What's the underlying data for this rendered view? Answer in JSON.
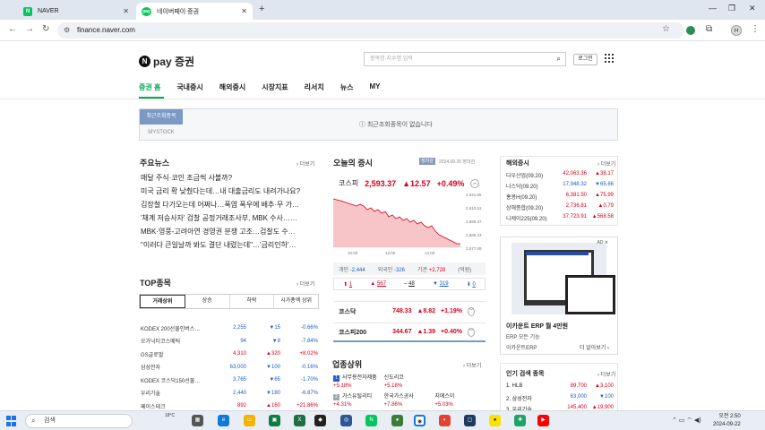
{
  "browser": {
    "tabs": [
      {
        "label": "NAVER",
        "favicon": "N"
      },
      {
        "label": "네이버페이 증권",
        "favicon": "pay"
      }
    ],
    "url": "finance.naver.com",
    "profile_initial": "H"
  },
  "header": {
    "logo_text": "pay 증권",
    "logo_mark": "N",
    "search_placeholder": "종목명·지수명 입력",
    "login_label": "로그인"
  },
  "gnb": [
    "증권 홈",
    "국내증시",
    "해외증시",
    "시장지표",
    "리서치",
    "뉴스",
    "MY"
  ],
  "recent": {
    "tab_recent": "최근조회종목",
    "tab_mystock": "MYSTOCK",
    "message": "최근조회종목이 없습니다"
  },
  "news": {
    "title": "주요뉴스",
    "more": "더보기",
    "items": [
      "매달 주식·코인 조금씩 사볼까?",
      "미국 금리 확 낮췄다는데…내 대출금리도 내려가나요?",
      "김장철 다가오는데 어쩌나…폭염 폭우에 배추·무 가…",
      "'채계 저승사자' 검찰 공정거래조사부, MBK 수사……",
      "MBK·영풍-고려아연 경영권 분쟁 고조…검찰도 수…",
      "\"이러다 큰일날까 봐도 결단 내렸는데\"…'금리인하'…"
    ]
  },
  "top": {
    "title": "TOP종목",
    "more": "더보기",
    "tabs": [
      "거래상위",
      "상승",
      "하락",
      "시가총액 상위"
    ],
    "rows": [
      {
        "name": "KODEX 200선물인버스…",
        "price": "2,255",
        "change": "▼15",
        "pct": "-0.66%",
        "dir": "dn"
      },
      {
        "name": "오가닉티코스메틱",
        "price": "94",
        "change": "▼8",
        "pct": "-7.84%",
        "dir": "dn"
      },
      {
        "name": "GS글로벌",
        "price": "4,310",
        "change": "▲320",
        "pct": "+8.02%",
        "dir": "up"
      },
      {
        "name": "삼성전자",
        "price": "63,000",
        "change": "▼100",
        "pct": "-0.16%",
        "dir": "dn"
      },
      {
        "name": "KODEX 코스닥150선물…",
        "price": "3,765",
        "change": "▼65",
        "pct": "-1.70%",
        "dir": "dn"
      },
      {
        "name": "우리기술",
        "price": "2,440",
        "change": "▼180",
        "pct": "-6.87%",
        "dir": "dn"
      },
      {
        "name": "페이스테크",
        "price": "892",
        "change": "▲160",
        "pct": "+21.86%",
        "dir": "up"
      }
    ]
  },
  "market": {
    "title": "오늘의 증시",
    "badge": "장마감",
    "date": "2024.09.20 장마감",
    "kospi": {
      "name": "코스피",
      "value": "2,593.37",
      "change": "▲12.57",
      "pct": "+0.49%"
    },
    "chart_yticks": [
      "2,621.65",
      "2,610.51",
      "2,599.37",
      "2,588.23",
      "2,577.09"
    ],
    "chart_xticks": [
      "10:00",
      "12:00",
      "14:00"
    ],
    "investors": [
      {
        "label": "개인",
        "value": "-2,444",
        "dir": "dn"
      },
      {
        "label": "외국인",
        "value": "-326",
        "dir": "dn"
      },
      {
        "label": "기관",
        "value": "+2,728",
        "dir": "up"
      },
      {
        "label": "(억원)",
        "value": "",
        "dir": ""
      }
    ],
    "arrows": [
      {
        "sym": "⬆",
        "val": "1",
        "dir": "up"
      },
      {
        "sym": "▲",
        "val": "567",
        "dir": "up"
      },
      {
        "sym": "–",
        "val": "48",
        "dir": ""
      },
      {
        "sym": "▼",
        "val": "319",
        "dir": "dn"
      },
      {
        "sym": "⬇",
        "val": "0",
        "dir": "dn"
      }
    ],
    "kosdaq": {
      "name": "코스닥",
      "value": "748.33",
      "change": "▲8.82",
      "pct": "+1.19%"
    },
    "kospi200": {
      "name": "코스피200",
      "value": "344.67",
      "change": "▲1.39",
      "pct": "+0.40%"
    }
  },
  "sectors": {
    "title": "업종상위",
    "more": "더보기",
    "rows": [
      [
        {
          "rank": "1",
          "name": "사무용전자제품",
          "pct": "+5.18%"
        },
        {
          "name": "신도리코",
          "pct": "+5.18%"
        },
        {
          "name": "",
          "pct": ""
        }
      ],
      [
        {
          "rank": "2",
          "name": "가스유틸리티",
          "pct": "+4.31%"
        },
        {
          "name": "한국가스공사",
          "pct": "+7.86%"
        },
        {
          "name": "지에스이",
          "pct": "+5.03%"
        }
      ]
    ]
  },
  "world": {
    "title": "해외증시",
    "more": "더보기",
    "rows": [
      {
        "name": "다우산업(09.20)",
        "price": "42,063.36",
        "change": "▲38.17",
        "dir": "up"
      },
      {
        "name": "나스닥(09.20)",
        "price": "17,948.32",
        "change": "▼65.66",
        "dir": "dn"
      },
      {
        "name": "홍콩H(09.20)",
        "price": "6,381.50",
        "change": "▲75.99",
        "dir": "up"
      },
      {
        "name": "상해종합(09.20)",
        "price": "2,736.81",
        "change": "▲0.79",
        "dir": "up"
      },
      {
        "name": "니케이225(09.20)",
        "price": "37,723.91",
        "change": "▲568.58",
        "dir": "up"
      }
    ]
  },
  "ad": {
    "tag": "AD",
    "title": "이카운트 ERP 월 4만원",
    "subtitle": "ERP 모든 기능",
    "brand": "이카운트ERP",
    "cta": "더 알아보기 ›"
  },
  "popular": {
    "title": "인기 검색 종목",
    "more": "더보기",
    "rows": [
      {
        "name": "1. HLB",
        "price": "89,700",
        "change": "▲3,100",
        "dir": "up"
      },
      {
        "name": "2. 삼성전자",
        "price": "63,000",
        "change": "▼100",
        "dir": "dn"
      },
      {
        "name": "3. 우리기술",
        "price": "145,400",
        "change": "▲19,900",
        "dir": "up"
      }
    ]
  },
  "taskbar": {
    "search_label": "검색",
    "weather_temp": "18°C",
    "time": "오전 2:50",
    "date": "2024-09-22"
  }
}
